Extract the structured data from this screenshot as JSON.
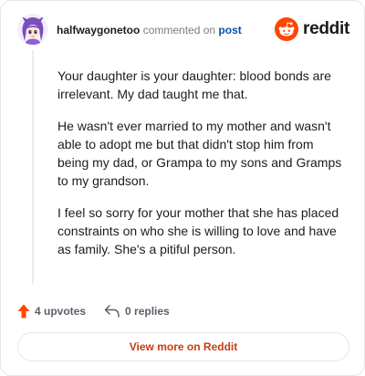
{
  "header": {
    "username": "halfwaygonetoo",
    "commented_text": "commented on",
    "post_link": "post",
    "avatar_icon": "anime-character-avatar-icon",
    "brand_logo_text": "reddit",
    "brand_logo_icon": "reddit-snoo-icon"
  },
  "comment": {
    "paragraphs": [
      "Your daughter is your daughter: blood bonds are irrelevant. My dad taught me that.",
      "He wasn't ever married to my mother and wasn't able to adopt me but that didn't stop him from being my dad, or Grampa to my sons and Gramps to my grandson.",
      "I feel so sorry for your mother that she has placed constraints on who she is willing to love and have as family. She's a pitiful person."
    ]
  },
  "actions": {
    "upvotes_label": "4 upvotes",
    "upvote_icon": "upvote-arrow-icon",
    "replies_label": "0 replies",
    "reply_icon": "reply-arrow-icon"
  },
  "footer": {
    "view_more_label": "View more on Reddit"
  },
  "colors": {
    "accent": "#ff4500",
    "link": "#0a4fa8",
    "view_more_text": "#c43d12",
    "border": "#e4e6e8"
  }
}
